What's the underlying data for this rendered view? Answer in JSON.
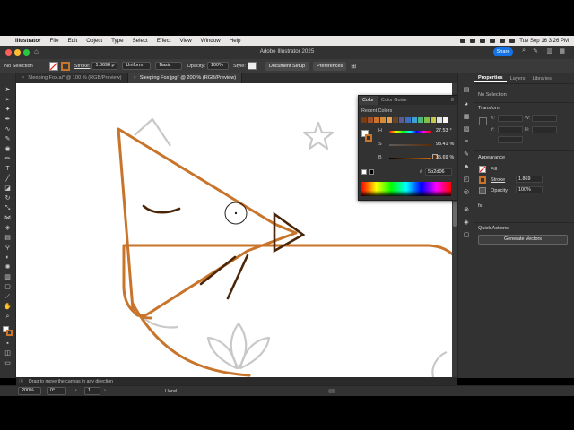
{
  "menubar": {
    "app_name": "Illustrator",
    "items": [
      "File",
      "Edit",
      "Object",
      "Type",
      "Select",
      "Effect",
      "View",
      "Window",
      "Help"
    ],
    "clock": "Tue Sep 16  3:26 PM"
  },
  "window": {
    "title": "Adobe Illustrator 2025",
    "share_label": "Share"
  },
  "controlbar": {
    "selection": "No Selection",
    "stroke_label": "Stroke:",
    "stroke_value": "1.8698 p",
    "uniform_label": "Uniform",
    "basic_label": "Basic",
    "opacity_label": "Opacity:",
    "opacity_value": "100%",
    "style_label": "Style:",
    "document_setup": "Document Setup",
    "preferences": "Preferences"
  },
  "tabs": [
    {
      "label": "Sleeping Fox.ai* @ 100 % (RGB/Preview)",
      "active": false
    },
    {
      "label": "Sleeping Fox.jpg* @ 200 % (RGB/Preview)",
      "active": true
    }
  ],
  "color_panel": {
    "tab_color": "Color",
    "tab_guide": "Color Guide",
    "recent_label": "Recent Colors",
    "swatches": [
      "#7a3b13",
      "#a0522d",
      "#c8742a",
      "#d88b3a",
      "#e6a24a",
      "#6b4226",
      "#5a5a9a",
      "#3b6fc2",
      "#3aa0d8",
      "#50b87a",
      "#7fbf4a",
      "#c8c84a",
      "#e0e0e0",
      "#f5f5f5"
    ],
    "h_label": "H",
    "h_value": "27.53",
    "s_label": "S",
    "s_value": "93.41",
    "b_label": "B",
    "b_value": "35.69",
    "h_unit": "°",
    "s_unit": "%",
    "b_unit": "%",
    "hex_prefix": "#",
    "hex_value": "5b2d06"
  },
  "properties": {
    "tab_properties": "Properties",
    "tab_layers": "Layers",
    "tab_libraries": "Libraries",
    "selection": "No Selection",
    "transform_label": "Transform",
    "x_label": "X:",
    "y_label": "Y:",
    "w_label": "W:",
    "h_label": "H:",
    "appearance_label": "Appearance",
    "fill_label": "Fill",
    "stroke_label": "Stroke",
    "stroke_value": "1.869",
    "opacity_label": "Opacity",
    "opacity_value": "100%",
    "fx_label": "fx.",
    "quick_actions_label": "Quick Actions",
    "generate_vectors": "Generate Vectors"
  },
  "statusbar": {
    "hint": "Drag to move the canvas in any direction"
  },
  "bottombar": {
    "zoom": "200%",
    "rotation": "0°",
    "artboard": "1",
    "mode": "Hand"
  },
  "colors": {
    "fox_stroke": "#c8742a",
    "dark_stroke": "#4a2508",
    "ghost": "#c4c4c4"
  }
}
